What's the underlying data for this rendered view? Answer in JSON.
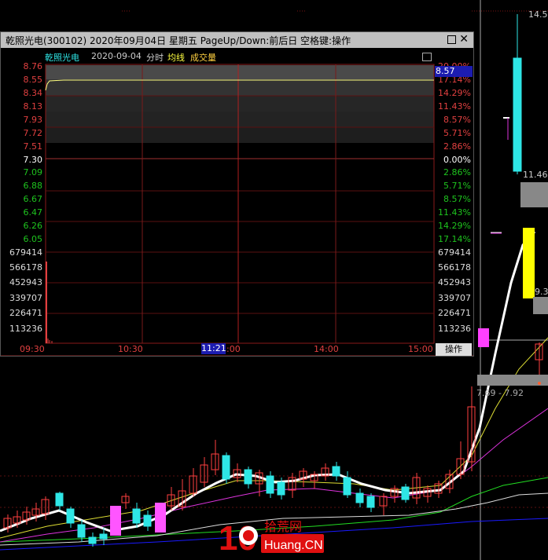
{
  "background_chart": {
    "price_labels": {
      "high": "14.5",
      "mid": "11.46",
      "low": "9.3"
    },
    "range_text": "7.69 - 7.92",
    "watermark": {
      "big": "10",
      "top": "拾荒网",
      "bottom": "Huang.CN"
    }
  },
  "popup": {
    "title": "乾照光电(300102)  2020年09月04日  星期五  PageUp/Down:前后日  空格键:操作",
    "stock_name": "乾照光电",
    "date": "2020-09-04",
    "mode": "分时",
    "avg_line": "均线",
    "volume": "成交量",
    "current_price": "8.57",
    "cursor_time": "11:21",
    "operate_button": "操作",
    "price_axis": [
      "8.76",
      "8.55",
      "8.34",
      "8.13",
      "7.93",
      "7.72",
      "7.51",
      "7.30",
      "7.09",
      "6.88",
      "6.67",
      "6.47",
      "6.26",
      "6.05"
    ],
    "pct_axis": [
      "20.00%",
      "17.14%",
      "14.29%",
      "11.43%",
      "8.57%",
      "5.71%",
      "2.86%",
      "0.00%",
      "2.86%",
      "5.71%",
      "8.57%",
      "11.43%",
      "14.29%",
      "17.14%"
    ],
    "volume_axis": [
      "679414",
      "566178",
      "452943",
      "339707",
      "226471",
      "113236"
    ],
    "time_axis": [
      "09:30",
      "10:30",
      ":00",
      "14:00",
      "15:00"
    ],
    "colors": {
      "up": "#e04040",
      "down": "#1ec31e",
      "neutral": "#ffffff",
      "name": "#2ee6e6",
      "avg": "#ffff40",
      "volume": "#ffd040"
    }
  }
}
